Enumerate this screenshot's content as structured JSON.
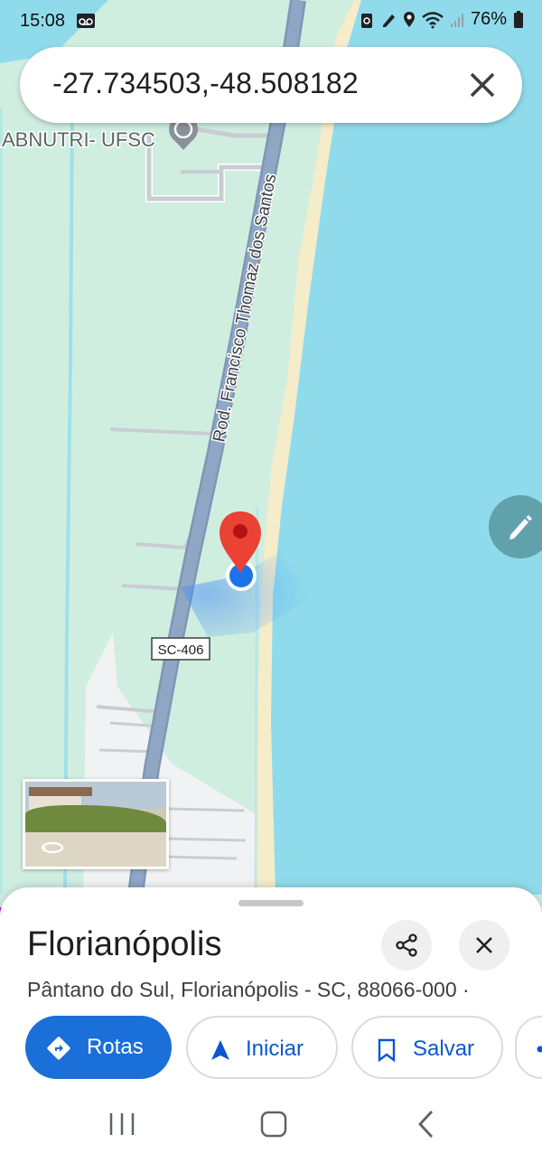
{
  "status_bar": {
    "time": "15:08",
    "battery": "76%",
    "icons": [
      "voicemail-icon",
      "recycle-icon",
      "pen-icon",
      "location-icon",
      "wifi-icon",
      "signal-icon",
      "battery-icon"
    ]
  },
  "search": {
    "query": "-27.734503,-48.508182",
    "close_icon": "close-icon"
  },
  "map": {
    "road_name": "Rod. Francisco Thomaz dos Santos",
    "road_shield": "SC-406",
    "poi_label": "ABNUTRI- UFSC",
    "colors": {
      "land": "#cfeee0",
      "water": "#8fdbeb",
      "beach": "#f5ecca",
      "road": "#8fa7c5",
      "pin": "#ea4335",
      "location_dot": "#1a73e8"
    }
  },
  "edit_fab": {
    "icon": "pencil-icon"
  },
  "street_view_thumb": {
    "icon": "rotate-360-icon"
  },
  "sheet": {
    "title": "Florianópolis",
    "address": "Pântano do Sul, Florianópolis - SC, 88066-000 ·",
    "share_icon": "share-icon",
    "close_icon": "close-icon",
    "actions": [
      {
        "label": "Rotas",
        "icon": "directions-icon"
      },
      {
        "label": "Iniciar",
        "icon": "navigation-arrow-icon"
      },
      {
        "label": "Salvar",
        "icon": "bookmark-icon"
      }
    ]
  },
  "nav_bar": {
    "icons": [
      "recents-icon",
      "home-icon",
      "back-icon"
    ]
  }
}
